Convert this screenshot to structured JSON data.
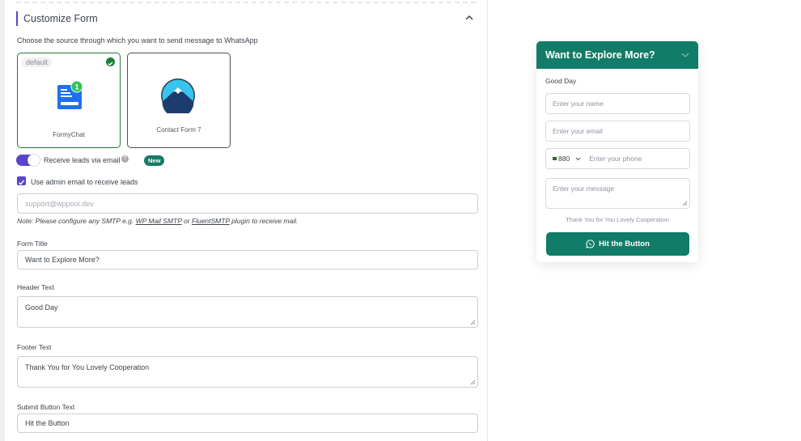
{
  "section": {
    "title": "Customize Form",
    "description": "Choose the source through which you want to send message to WhatsApp"
  },
  "sources": [
    {
      "label": "FormyChat",
      "badge": "default",
      "selected": true
    },
    {
      "label": "Contact Form 7",
      "selected": false
    }
  ],
  "email_toggle": {
    "label": "Receive leads via email",
    "enabled": true,
    "badge": "New"
  },
  "admin_email": {
    "label": "Use admin email to receive leads",
    "checked": true,
    "placeholder": "support@wppool.dev"
  },
  "note": {
    "prefix": "Note: Please configure any SMTP e.g. ",
    "link1": "WP Mail SMTP",
    "mid": " or ",
    "link2": "FluentSMTP",
    "suffix": " plugin to receive mail."
  },
  "fields": {
    "form_title": {
      "label": "Form Title",
      "value": "Want to Explore More?"
    },
    "header_text": {
      "label": "Header Text",
      "value": "Good Day"
    },
    "footer_text": {
      "label": "Footer Text",
      "value": "Thank You for You Lovely Cooperation"
    },
    "submit_text": {
      "label": "Submit Button Text",
      "value": "Hit the Button"
    }
  },
  "preview": {
    "title": "Want to Explore More?",
    "greeting": "Good Day",
    "name_placeholder": "Enter your name",
    "email_placeholder": "Enter your email",
    "country_code": "880",
    "phone_placeholder": "Enter your phone",
    "message_placeholder": "Enter your message",
    "footer": "Thank You for You Lovely Cooperation",
    "button": "Hit the Button"
  },
  "colors": {
    "accent": "#5b44c9",
    "brand_green": "#117c67",
    "selected_border": "#1e7a3a"
  }
}
